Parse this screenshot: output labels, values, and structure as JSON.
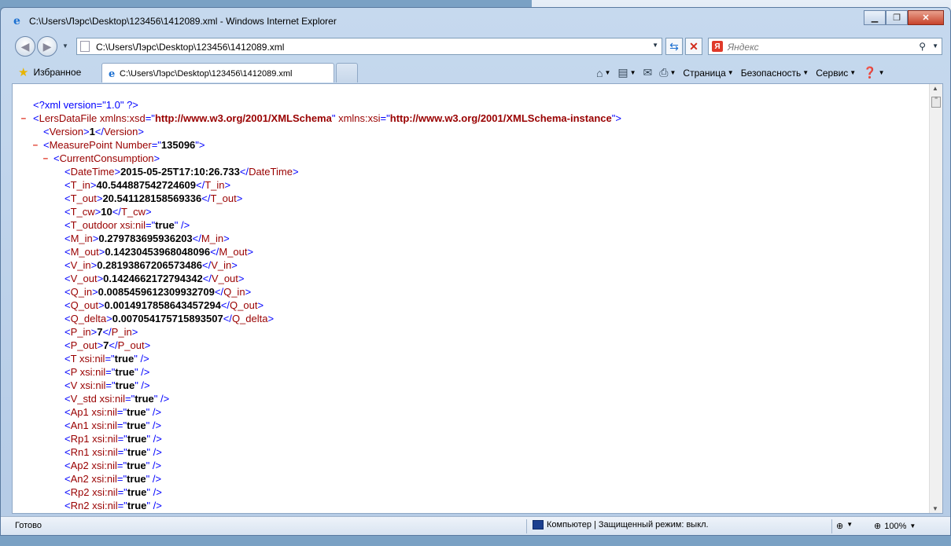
{
  "window": {
    "title": "C:\\Users\\Лэрс\\Desktop\\123456\\1412089.xml - Windows Internet Explorer"
  },
  "address": {
    "url": "C:\\Users\\Лэрс\\Desktop\\123456\\1412089.xml"
  },
  "search": {
    "placeholder": "Яндекс",
    "provider_badge": "Я"
  },
  "favorites": {
    "label": "Избранное"
  },
  "tab": {
    "label": "C:\\Users\\Лэрс\\Desktop\\123456\\1412089.xml"
  },
  "commands": {
    "page": "Страница",
    "safety": "Безопасность",
    "tools": "Сервис"
  },
  "status": {
    "text": "Готово",
    "zone": "Компьютер | Защищенный режим: выкл.",
    "zoom": "100%"
  },
  "xml": {
    "declaration": "<?xml version=\"1.0\" ?>",
    "root_tag": "LersDataFile",
    "xsd_attr": "xmlns:xsd",
    "xsd_val": "http://www.w3.org/2001/XMLSchema",
    "xsi_attr": "xmlns:xsi",
    "xsi_val": "http://www.w3.org/2001/XMLSchema-instance",
    "version_tag": "Version",
    "version_val": "1",
    "mp_tag": "MeasurePoint",
    "mp_attr": "Number",
    "mp_val": "135096",
    "cc_tag": "CurrentConsumption",
    "values": [
      {
        "tag": "DateTime",
        "value": "2015-05-25T17:10:26.733"
      },
      {
        "tag": "T_in",
        "value": "40.544887542724609"
      },
      {
        "tag": "T_out",
        "value": "20.541128158569336"
      },
      {
        "tag": "T_cw",
        "value": "10"
      },
      {
        "tag": "T_outdoor",
        "nil": "true"
      },
      {
        "tag": "M_in",
        "value": "0.279783695936203"
      },
      {
        "tag": "M_out",
        "value": "0.14230453968048096"
      },
      {
        "tag": "V_in",
        "value": "0.28193867206573486"
      },
      {
        "tag": "V_out",
        "value": "0.1424662172794342"
      },
      {
        "tag": "Q_in",
        "value": "0.0085459612309932709"
      },
      {
        "tag": "Q_out",
        "value": "0.0014917858643457294"
      },
      {
        "tag": "Q_delta",
        "value": "0.007054175715893507"
      },
      {
        "tag": "P_in",
        "value": "7"
      },
      {
        "tag": "P_out",
        "value": "7"
      },
      {
        "tag": "T",
        "nil": "true"
      },
      {
        "tag": "P",
        "nil": "true"
      },
      {
        "tag": "V",
        "nil": "true"
      },
      {
        "tag": "V_std",
        "nil": "true"
      },
      {
        "tag": "Ap1",
        "nil": "true"
      },
      {
        "tag": "An1",
        "nil": "true"
      },
      {
        "tag": "Rp1",
        "nil": "true"
      },
      {
        "tag": "Rn1",
        "nil": "true"
      },
      {
        "tag": "Ap2",
        "nil": "true"
      },
      {
        "tag": "An2",
        "nil": "true"
      },
      {
        "tag": "Rp2",
        "nil": "true"
      },
      {
        "tag": "Rn2",
        "nil": "true"
      }
    ],
    "nil_attr": "xsi:nil",
    "collapse_symbol": "–"
  }
}
